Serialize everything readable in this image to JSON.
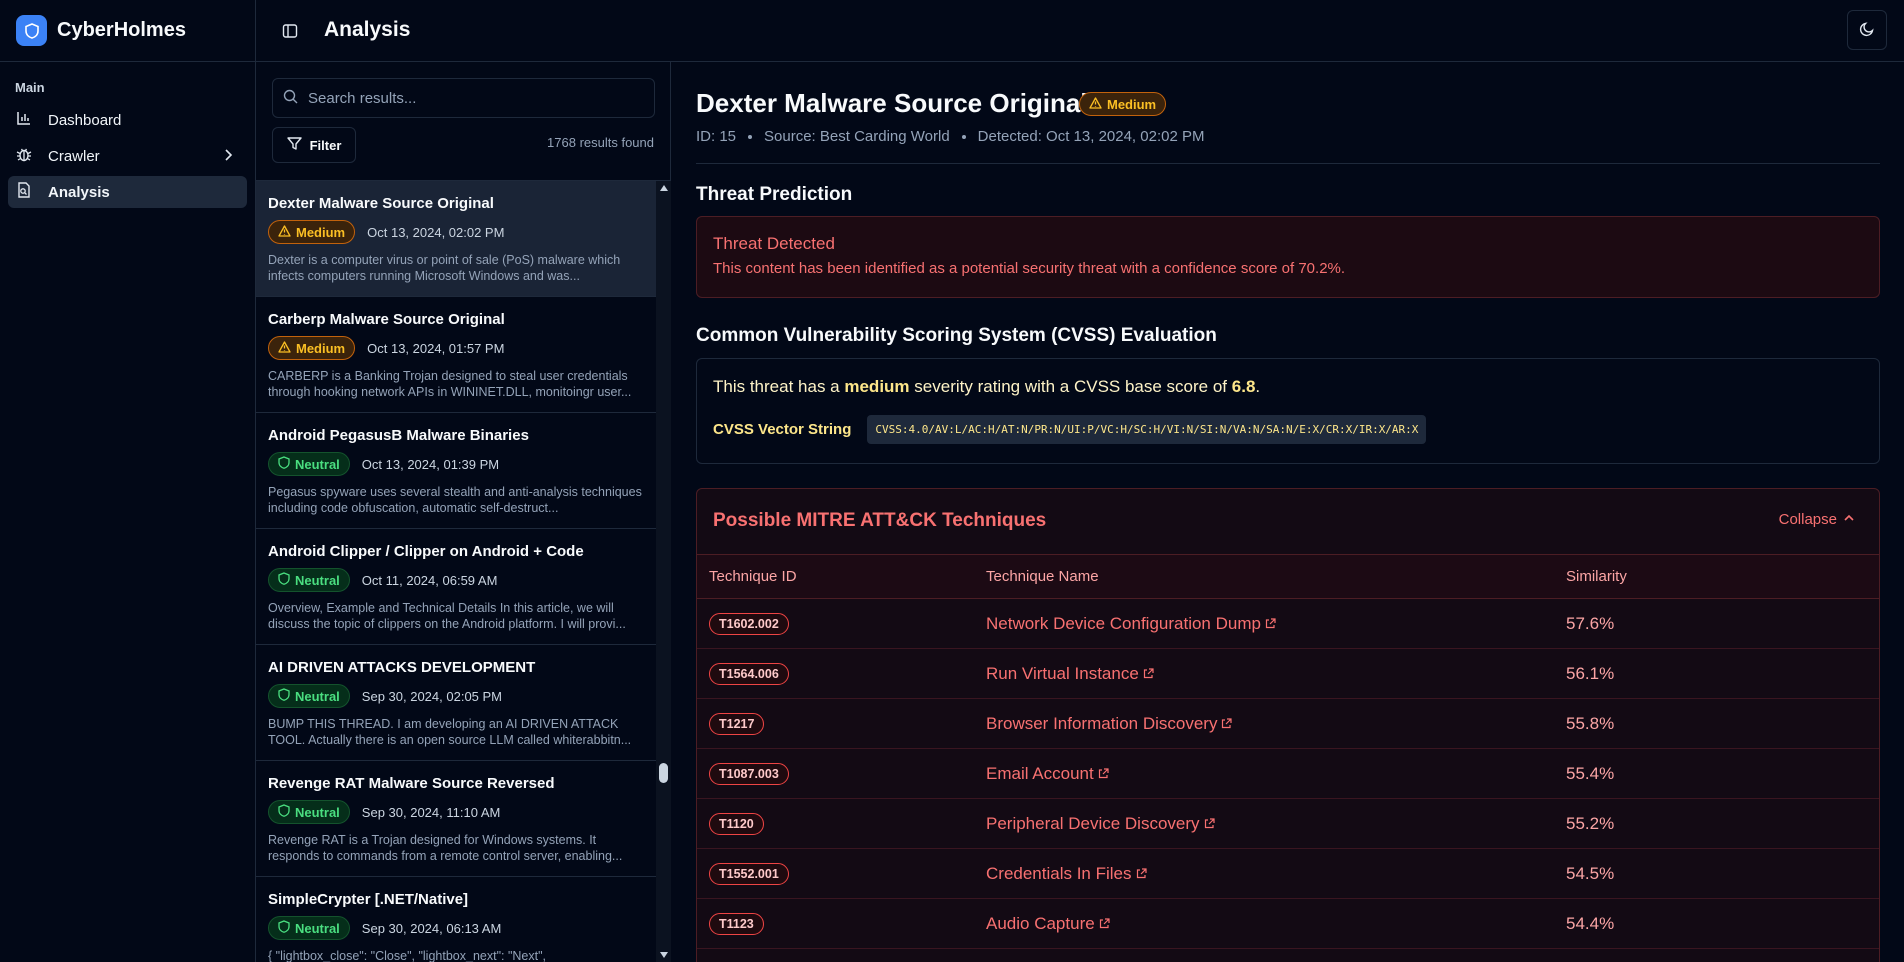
{
  "app": {
    "name": "CyberHolmes"
  },
  "topbar": {
    "title": "Analysis"
  },
  "sidebar": {
    "group_label": "Main",
    "items": [
      {
        "label": "Dashboard",
        "icon": "bar-chart-icon"
      },
      {
        "label": "Crawler",
        "icon": "bug-icon"
      },
      {
        "label": "Analysis",
        "icon": "file-search-icon"
      }
    ]
  },
  "list": {
    "search_placeholder": "Search results...",
    "filter_label": "Filter",
    "count_text": "1768 results found",
    "items": [
      {
        "title": "Dexter Malware Source Original",
        "severity": "Medium",
        "date": "Oct 13, 2024, 02:02 PM",
        "desc": "Dexter is a computer virus or point of sale (PoS) malware which infects computers running Microsoft Windows and was..."
      },
      {
        "title": "Carberp Malware Source Original",
        "severity": "Medium",
        "date": "Oct 13, 2024, 01:57 PM",
        "desc": "CARBERP is a Banking Trojan designed to steal user credentials through hooking network APIs in WININET.DLL, monitoingr user..."
      },
      {
        "title": "Android PegasusB Malware Binaries",
        "severity": "Neutral",
        "date": "Oct 13, 2024, 01:39 PM",
        "desc": "Pegasus spyware uses several stealth and anti-analysis techniques including code obfuscation, automatic self-destruct..."
      },
      {
        "title": "Android Clipper / Clipper on Android + Code",
        "severity": "Neutral",
        "date": "Oct 11, 2024, 06:59 AM",
        "desc": "Overview, Example and Technical Details In this article, we will discuss the topic of clippers on the Android platform. I will provi..."
      },
      {
        "title": "AI DRIVEN ATTACKS DEVELOPMENT",
        "severity": "Neutral",
        "date": "Sep 30, 2024, 02:05 PM",
        "desc": "BUMP THIS THREAD. I am developing an AI DRIVEN ATTACK TOOL. Actually there is an open source LLM called whiterabbitn..."
      },
      {
        "title": "Revenge RAT Malware Source Reversed",
        "severity": "Neutral",
        "date": "Sep 30, 2024, 11:10 AM",
        "desc": "Revenge RAT is a Trojan designed for Windows systems. It responds to commands from a remote control server, enabling..."
      },
      {
        "title": "SimpleCrypter [.NET/Native]",
        "severity": "Neutral",
        "date": "Sep 30, 2024, 06:13 AM",
        "desc": "{ \"lightbox_close\": \"Close\", \"lightbox_next\": \"Next\","
      }
    ]
  },
  "detail": {
    "title": "Dexter Malware Source Original",
    "severity": "Medium",
    "id_text": "ID: 15",
    "source_text": "Source: Best Carding World",
    "detected_text": "Detected: Oct 13, 2024, 02:02 PM",
    "threat_heading": "Threat Prediction",
    "threat_title": "Threat Detected",
    "threat_text": "This content has been identified as a potential security threat with a confidence score of 70.2%.",
    "cvss_heading": "Common Vulnerability Scoring System (CVSS) Evaluation",
    "cvss_pre": "This threat has a",
    "cvss_severity": "medium",
    "cvss_mid": "severity rating with a CVSS base score of",
    "cvss_score": "6.8",
    "cvss_end": ".",
    "cvss_vector_label": "CVSS Vector String",
    "cvss_vector": "CVSS:4.0/AV:L/AC:H/AT:N/PR:N/UI:P/VC:H/SC:H/VI:N/SI:N/VA:N/SA:N/E:X/CR:X/IR:X/AR:X",
    "mitre_title": "Possible MITRE ATT&CK Techniques",
    "collapse_label": "Collapse",
    "table_headers": [
      "Technique ID",
      "Technique Name",
      "Similarity"
    ],
    "techniques": [
      {
        "id": "T1602.002",
        "name": "Network Device Configuration Dump",
        "similarity": "57.6%"
      },
      {
        "id": "T1564.006",
        "name": "Run Virtual Instance",
        "similarity": "56.1%"
      },
      {
        "id": "T1217",
        "name": "Browser Information Discovery",
        "similarity": "55.8%"
      },
      {
        "id": "T1087.003",
        "name": "Email Account",
        "similarity": "55.4%"
      },
      {
        "id": "T1120",
        "name": "Peripheral Device Discovery",
        "similarity": "55.2%"
      },
      {
        "id": "T1552.001",
        "name": "Credentials In Files",
        "similarity": "54.5%"
      },
      {
        "id": "T1123",
        "name": "Audio Capture",
        "similarity": "54.4%"
      }
    ]
  },
  "colors": {
    "accent": "#3b82f6",
    "medium": "#fbbf24",
    "neutral": "#4ade80",
    "threat": "#f87171"
  }
}
